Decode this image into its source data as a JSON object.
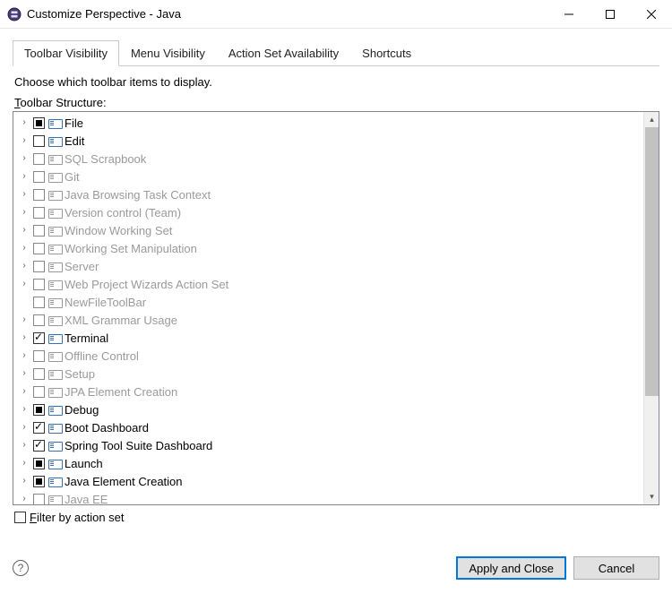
{
  "window": {
    "title": "Customize Perspective - Java",
    "minimize_tip": "Minimize",
    "maximize_tip": "Maximize",
    "close_tip": "Close"
  },
  "tabs": [
    {
      "id": "toolbar-visibility",
      "label": "Toolbar Visibility",
      "active": true
    },
    {
      "id": "menu-visibility",
      "label": "Menu Visibility",
      "active": false
    },
    {
      "id": "action-set-availability",
      "label": "Action Set Availability",
      "active": false
    },
    {
      "id": "shortcuts",
      "label": "Shortcuts",
      "active": false
    }
  ],
  "subtitle": "Choose which toolbar items to display.",
  "section_label_prefix": "T",
  "section_label_rest": "oolbar Structure:",
  "tree": [
    {
      "label": "File",
      "state": "partial",
      "enabled": true,
      "expandable": true
    },
    {
      "label": "Edit",
      "state": "unchecked",
      "enabled": true,
      "expandable": true
    },
    {
      "label": "SQL Scrapbook",
      "state": "unchecked",
      "enabled": false,
      "expandable": true
    },
    {
      "label": "Git",
      "state": "unchecked",
      "enabled": false,
      "expandable": true
    },
    {
      "label": "Java Browsing Task Context",
      "state": "unchecked",
      "enabled": false,
      "expandable": true
    },
    {
      "label": "Version control (Team)",
      "state": "unchecked",
      "enabled": false,
      "expandable": true
    },
    {
      "label": "Window Working Set",
      "state": "unchecked",
      "enabled": false,
      "expandable": true
    },
    {
      "label": "Working Set Manipulation",
      "state": "unchecked",
      "enabled": false,
      "expandable": true
    },
    {
      "label": "Server",
      "state": "unchecked",
      "enabled": false,
      "expandable": true
    },
    {
      "label": "Web Project Wizards Action Set",
      "state": "unchecked",
      "enabled": false,
      "expandable": true
    },
    {
      "label": "NewFileToolBar",
      "state": "unchecked",
      "enabled": false,
      "expandable": false
    },
    {
      "label": "XML Grammar Usage",
      "state": "unchecked",
      "enabled": false,
      "expandable": true
    },
    {
      "label": "Terminal",
      "state": "checked",
      "enabled": true,
      "expandable": true
    },
    {
      "label": "Offline Control",
      "state": "unchecked",
      "enabled": false,
      "expandable": true
    },
    {
      "label": "Setup",
      "state": "unchecked",
      "enabled": false,
      "expandable": true
    },
    {
      "label": "JPA Element Creation",
      "state": "unchecked",
      "enabled": false,
      "expandable": true
    },
    {
      "label": "Debug",
      "state": "partial",
      "enabled": true,
      "expandable": true
    },
    {
      "label": "Boot Dashboard",
      "state": "checked",
      "enabled": true,
      "expandable": true
    },
    {
      "label": "Spring Tool Suite Dashboard",
      "state": "checked",
      "enabled": true,
      "expandable": true
    },
    {
      "label": "Launch",
      "state": "partial",
      "enabled": true,
      "expandable": true
    },
    {
      "label": "Java Element Creation",
      "state": "partial",
      "enabled": true,
      "expandable": true
    },
    {
      "label": "Java EE",
      "state": "unchecked",
      "enabled": false,
      "expandable": true
    }
  ],
  "filter": {
    "checked": false,
    "label_prefix": "F",
    "label_rest": "ilter by action set"
  },
  "buttons": {
    "apply": "Apply and Close",
    "cancel": "Cancel"
  },
  "help_tip": "Help"
}
